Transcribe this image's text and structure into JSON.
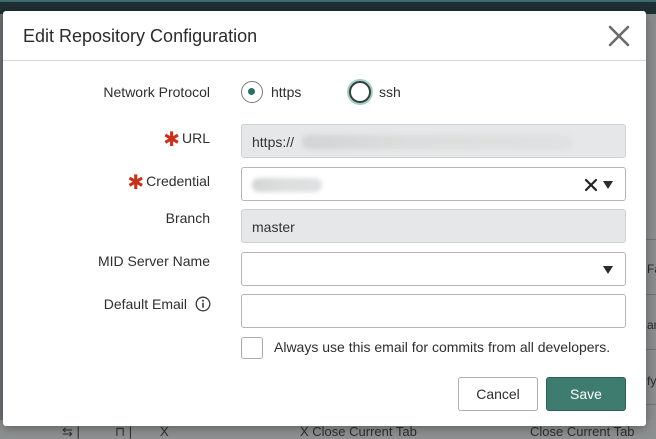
{
  "background": {
    "right_fragments": [
      "Fa",
      "an",
      "fy"
    ],
    "bottom_items": [
      "⇆ |",
      "⊓ |",
      "X",
      "X Close Current Tab",
      "Close Current Tab"
    ]
  },
  "dialog": {
    "title": "Edit Repository Configuration",
    "close_icon": "close-x-icon"
  },
  "form": {
    "protocol": {
      "label": "Network Protocol",
      "options": [
        {
          "label": "https",
          "selected": true
        },
        {
          "label": "ssh",
          "selected": false
        }
      ]
    },
    "url": {
      "label": "URL",
      "required": true,
      "value_prefix": "https://"
    },
    "credential": {
      "label": "Credential",
      "required": true
    },
    "branch": {
      "label": "Branch",
      "value": "master"
    },
    "mid_server": {
      "label": "MID Server Name",
      "value": ""
    },
    "default_email": {
      "label": "Default Email",
      "value": "",
      "info_icon": "info-circle-icon"
    },
    "always_use_email": {
      "label": "Always use this email for commits from all developers.",
      "checked": false
    }
  },
  "buttons": {
    "cancel": "Cancel",
    "save": "Save"
  },
  "colors": {
    "primary": "#3f7c70",
    "required": "#c8321c",
    "readonly_bg": "#e6e7e8"
  }
}
